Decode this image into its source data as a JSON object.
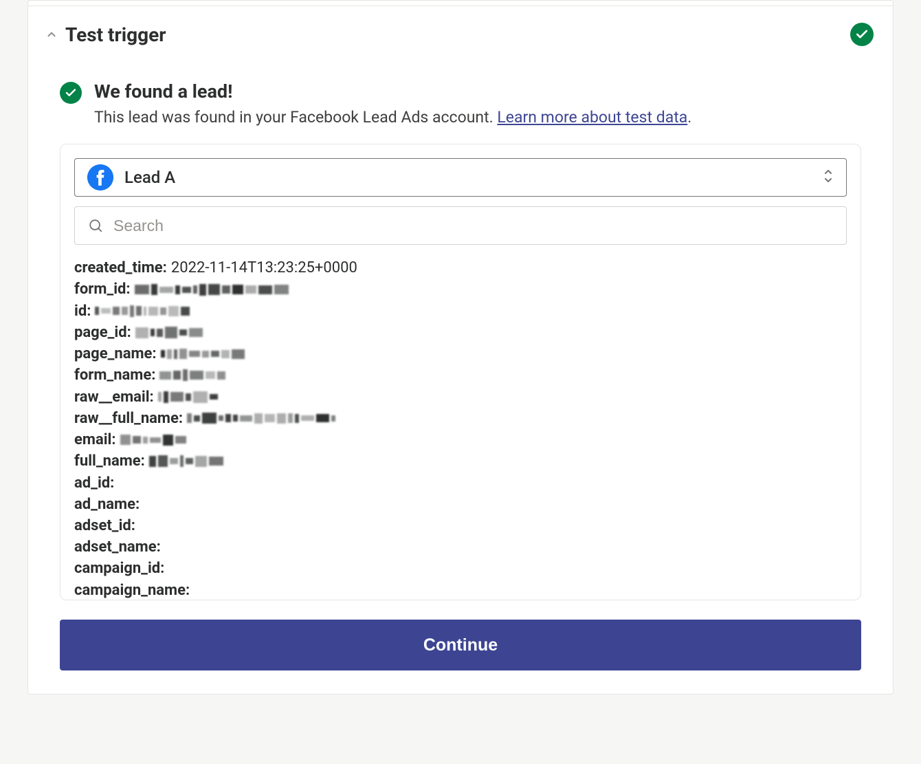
{
  "section": {
    "title": "Test trigger"
  },
  "status": {
    "heading": "We found a lead!",
    "sub_prefix": "This lead was found in your Facebook Lead Ads account. ",
    "link_text": "Learn more about test data",
    "sub_suffix": "."
  },
  "lead_select": {
    "label": "Lead A",
    "icon": "facebook-icon"
  },
  "search": {
    "placeholder": "Search"
  },
  "fields": [
    {
      "key": "created_time:",
      "value": "2022-11-14T13:23:25+0000",
      "redacted": false
    },
    {
      "key": "form_id:",
      "value": "",
      "redacted": true
    },
    {
      "key": "id:",
      "value": "",
      "redacted": true
    },
    {
      "key": "page_id:",
      "value": "",
      "redacted": true
    },
    {
      "key": "page_name:",
      "value": "",
      "redacted": true
    },
    {
      "key": "form_name:",
      "value": "",
      "redacted": true
    },
    {
      "key": "raw__email:",
      "value": "",
      "redacted": true
    },
    {
      "key": "raw__full_name:",
      "value": "",
      "redacted": true
    },
    {
      "key": "email:",
      "value": "",
      "redacted": true
    },
    {
      "key": "full_name:",
      "value": "",
      "redacted": true
    },
    {
      "key": "ad_id:",
      "value": "",
      "redacted": false
    },
    {
      "key": "ad_name:",
      "value": "",
      "redacted": false
    },
    {
      "key": "adset_id:",
      "value": "",
      "redacted": false
    },
    {
      "key": "adset_name:",
      "value": "",
      "redacted": false
    },
    {
      "key": "campaign_id:",
      "value": "",
      "redacted": false
    },
    {
      "key": "campaign_name:",
      "value": "",
      "redacted": false
    }
  ],
  "continue": {
    "label": "Continue"
  },
  "colors": {
    "success": "#038347",
    "primary": "#3d4592",
    "facebook": "#1877f2"
  }
}
